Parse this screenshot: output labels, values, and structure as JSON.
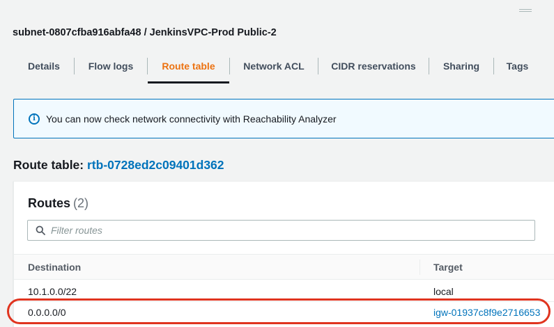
{
  "header": {
    "subnet_title": "subnet-0807cfba916abfa48 / JenkinsVPC-Prod Public-2"
  },
  "tabs": [
    {
      "label": "Details",
      "active": false
    },
    {
      "label": "Flow logs",
      "active": false
    },
    {
      "label": "Route table",
      "active": true
    },
    {
      "label": "Network ACL",
      "active": false
    },
    {
      "label": "CIDR reservations",
      "active": false
    },
    {
      "label": "Sharing",
      "active": false
    },
    {
      "label": "Tags",
      "active": false
    }
  ],
  "alert": {
    "icon": "info-icon",
    "text": "You can now check network connectivity with Reachability Analyzer"
  },
  "route_table": {
    "label": "Route table:",
    "id": "rtb-0728ed2c09401d362"
  },
  "routes": {
    "title": "Routes",
    "count": "(2)",
    "filter_placeholder": "Filter routes",
    "columns": [
      "Destination",
      "Target"
    ],
    "rows": [
      {
        "destination": "10.1.0.0/22",
        "target": "local",
        "target_is_link": false
      },
      {
        "destination": "0.0.0.0/0",
        "target": "igw-01937c8f9e2716653",
        "target_is_link": true
      }
    ]
  },
  "colors": {
    "active_tab": "#ec7211",
    "link": "#0073bb",
    "highlight": "#e0341f"
  }
}
